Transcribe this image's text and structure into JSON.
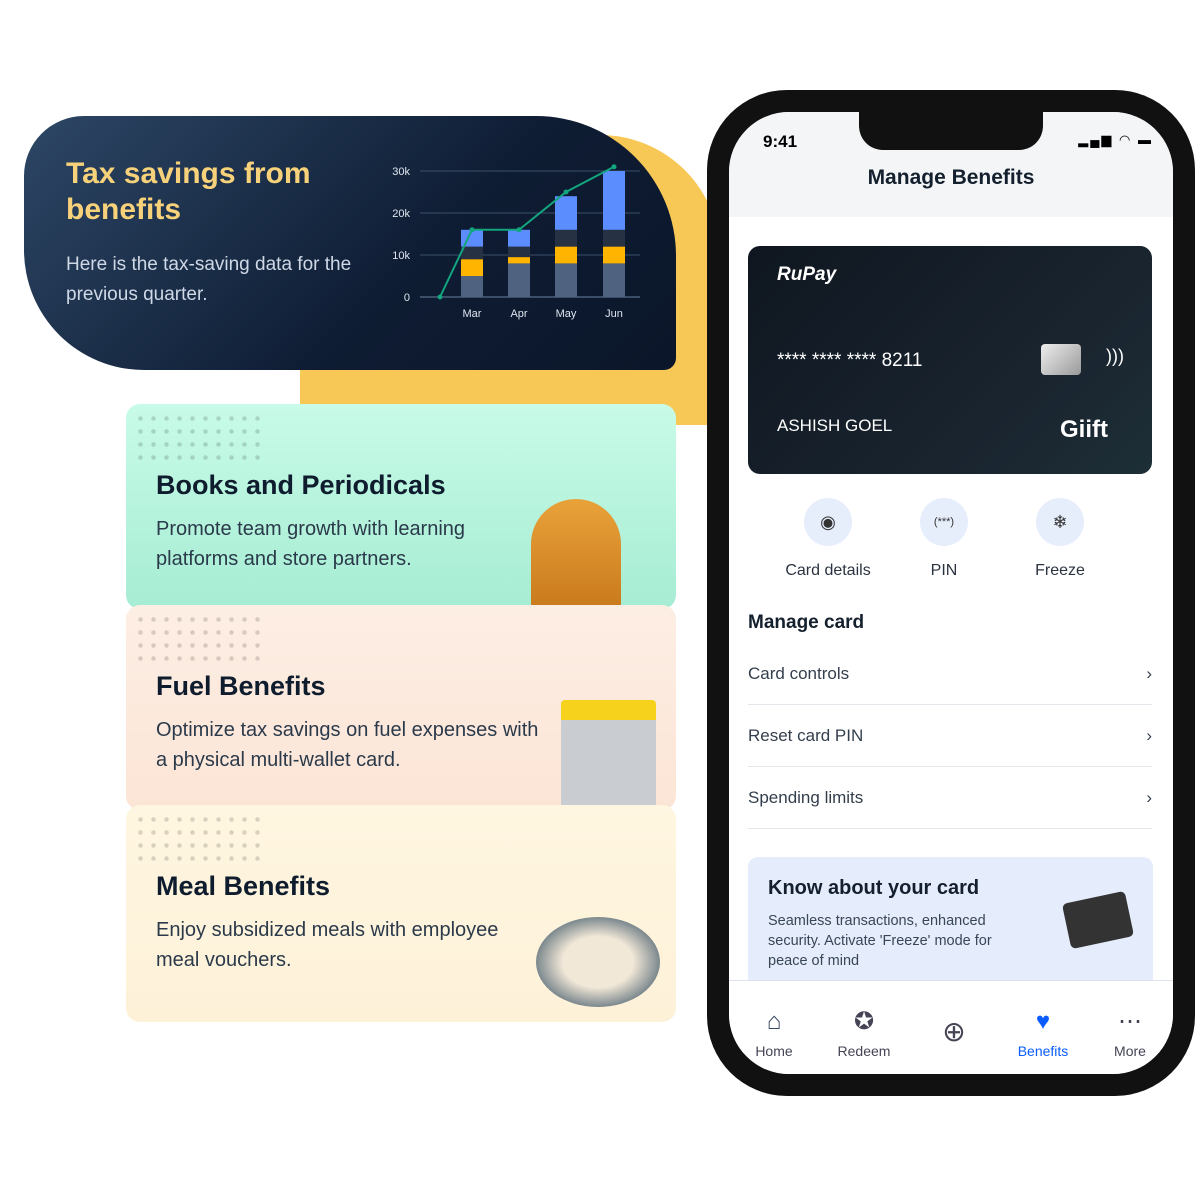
{
  "tax_card": {
    "title": "Tax savings from benefits",
    "subtitle": "Here is the tax-saving  data for the previous quarter."
  },
  "chart_data": {
    "type": "bar",
    "stacked": true,
    "categories": [
      "Mar",
      "Apr",
      "May",
      "Jun"
    ],
    "yticks": [
      "0",
      "10k",
      "20k",
      "30k"
    ],
    "ylim": [
      0,
      30000
    ],
    "grid": true,
    "series": [
      {
        "values": [
          5000,
          8000,
          8000,
          8000
        ],
        "color": "#4f6380"
      },
      {
        "values": [
          4000,
          1500,
          4000,
          4000
        ],
        "color": "#ffb400"
      },
      {
        "values": [
          3000,
          2500,
          4000,
          4000
        ],
        "color": "#263244"
      },
      {
        "values": [
          4000,
          4000,
          8000,
          14000
        ],
        "color": "#5b8dff"
      }
    ],
    "line": {
      "values": [
        0,
        16000,
        16000,
        25000,
        31000
      ],
      "color": "#12a57e"
    }
  },
  "cards": [
    {
      "title": "Books and Periodicals",
      "desc": "Promote team growth with learning platforms and store partners."
    },
    {
      "title": "Fuel Benefits",
      "desc": "Optimize tax savings on fuel expenses with a physical multi-wallet card."
    },
    {
      "title": "Meal Benefits",
      "desc": "Enjoy subsidized meals with employee meal vouchers."
    }
  ],
  "phone": {
    "time": "9:41",
    "title": "Manage Benefits",
    "card": {
      "brand": "RuPay",
      "number": "**** **** **** 8211",
      "name": "ASHISH GOEL",
      "issuer": "Giift"
    },
    "actions": [
      {
        "label": "Card details",
        "icon": "eye-icon"
      },
      {
        "label": "PIN",
        "icon": "pin-icon"
      },
      {
        "label": "Freeze",
        "icon": "snowflake-icon"
      }
    ],
    "manage_title": "Manage card",
    "rows": [
      "Card controls",
      "Reset card PIN",
      "Spending limits"
    ],
    "info": {
      "title": "Know about your card",
      "text": "Seamless transactions, enhanced security. Activate 'Freeze' mode for peace of mind"
    },
    "nav": [
      {
        "label": "Home"
      },
      {
        "label": "Redeem"
      },
      {
        "label": ""
      },
      {
        "label": "Benefits"
      },
      {
        "label": "More"
      }
    ],
    "accent": "#0a5cff"
  }
}
